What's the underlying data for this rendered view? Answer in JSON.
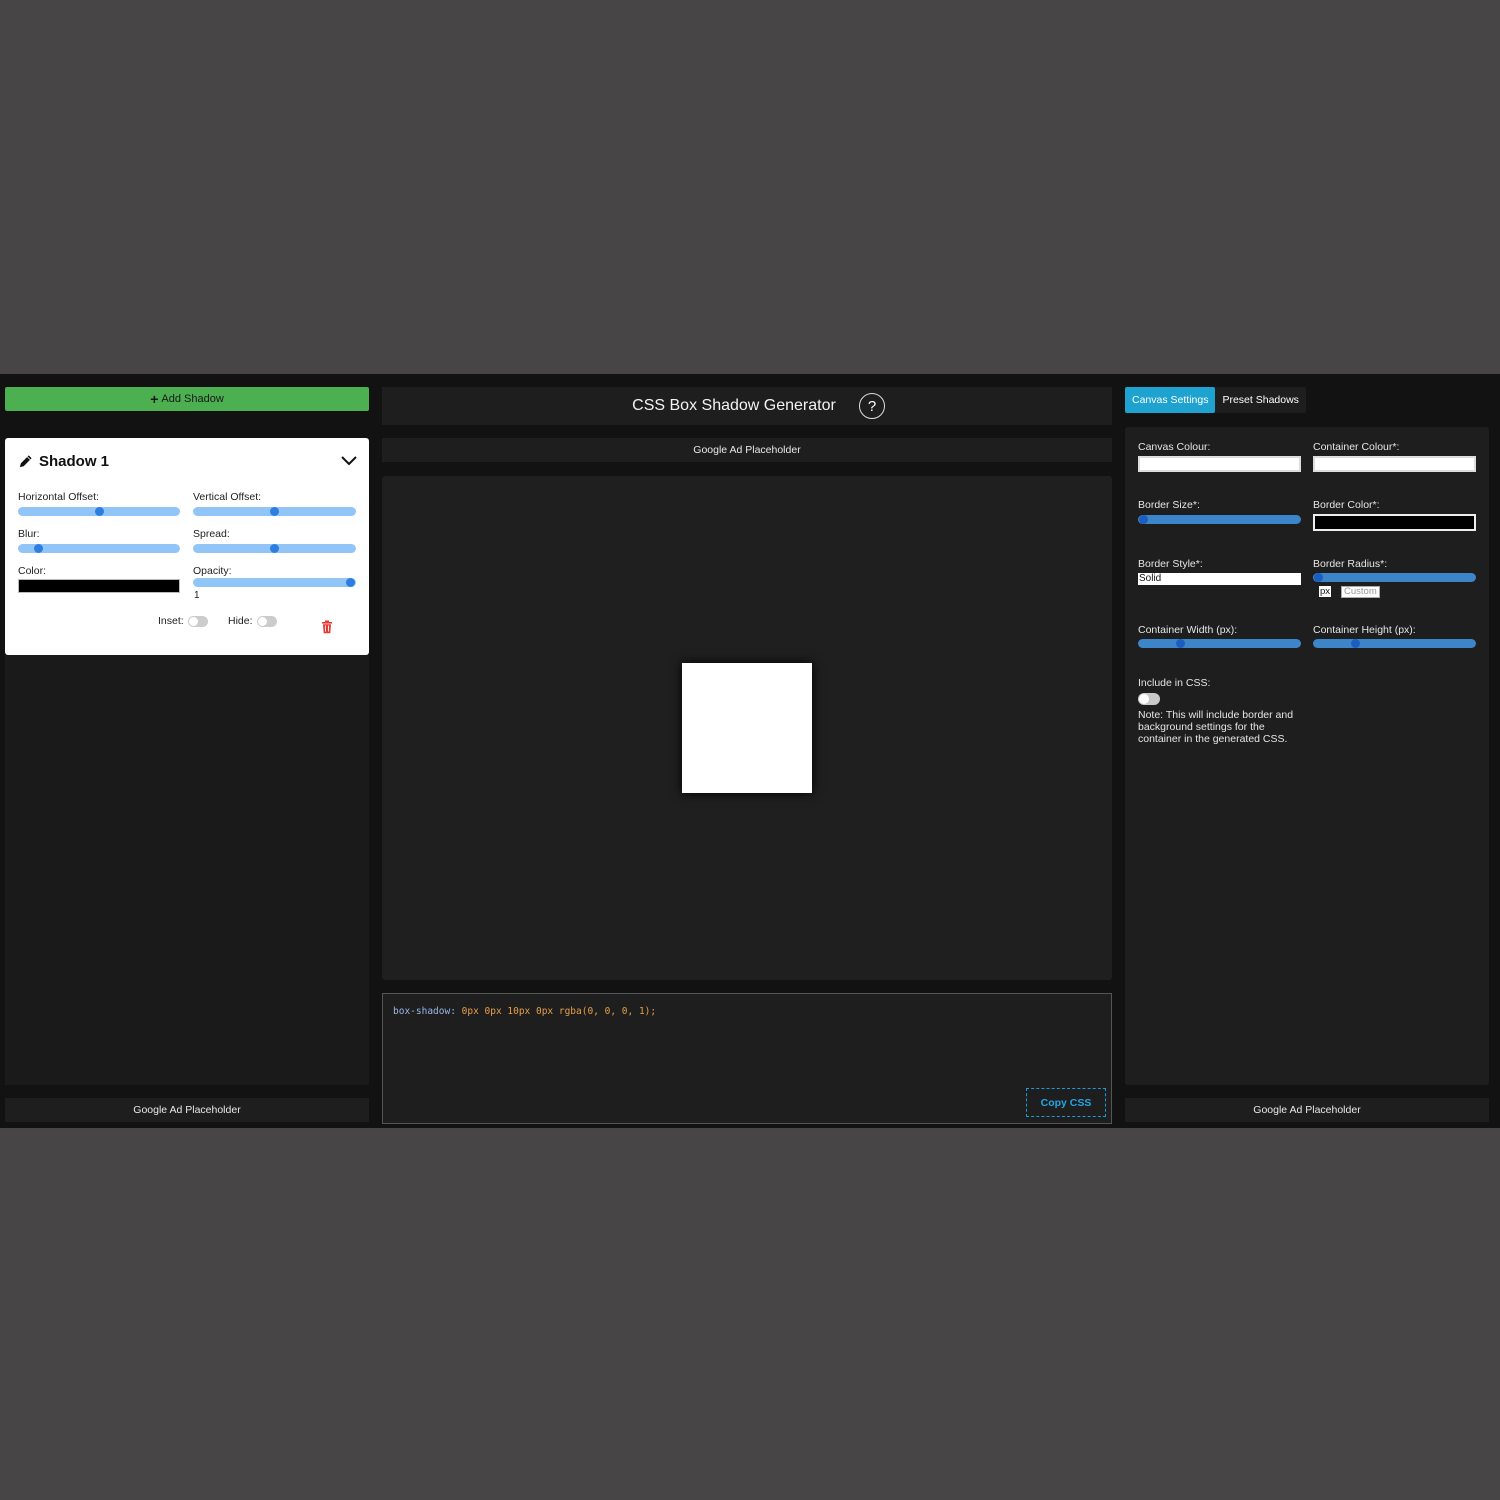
{
  "left": {
    "add_shadow_label": "Add Shadow",
    "shadow_card": {
      "title": "Shadow 1",
      "horizontal_offset_label": "Horizontal Offset:",
      "vertical_offset_label": "Vertical Offset:",
      "blur_label": "Blur:",
      "spread_label": "Spread:",
      "color_label": "Color:",
      "color_value": "#000000",
      "opacity_label": "Opacity:",
      "opacity_value": "1",
      "inset_label": "Inset:",
      "hide_label": "Hide:"
    },
    "ad_label": "Google Ad Placeholder"
  },
  "center": {
    "title": "CSS Box Shadow Generator",
    "help_label": "?",
    "ad_label": "Google Ad Placeholder",
    "code": {
      "property": "box-shadow:",
      "value": " 0px 0px 10px 0px rgba(0, 0, 0, 1);"
    },
    "copy_label": "Copy CSS"
  },
  "right": {
    "tabs": [
      {
        "label": "Canvas Settings",
        "active": true
      },
      {
        "label": "Preset Shadows",
        "active": false
      }
    ],
    "canvas_colour_label": "Canvas Colour:",
    "container_colour_label": "Container Colour*:",
    "border_size_label": "Border Size*:",
    "border_color_label": "Border Color*:",
    "border_style_label": "Border Style*:",
    "border_style_value": "Solid",
    "border_radius_label": "Border Radius*:",
    "border_radius_unit": "px",
    "custom_placeholder": "Custom",
    "container_width_label": "Container Width (px):",
    "container_height_label": "Container Height (px):",
    "include_css_label": "Include in CSS:",
    "note": "Note: This will include border and background settings for the container in the generated CSS.",
    "ad_label": "Google Ad Placeholder"
  },
  "colors": {
    "accent_green": "#4caf50",
    "accent_blue": "#1ea2cf",
    "delete_red": "#e53935"
  }
}
